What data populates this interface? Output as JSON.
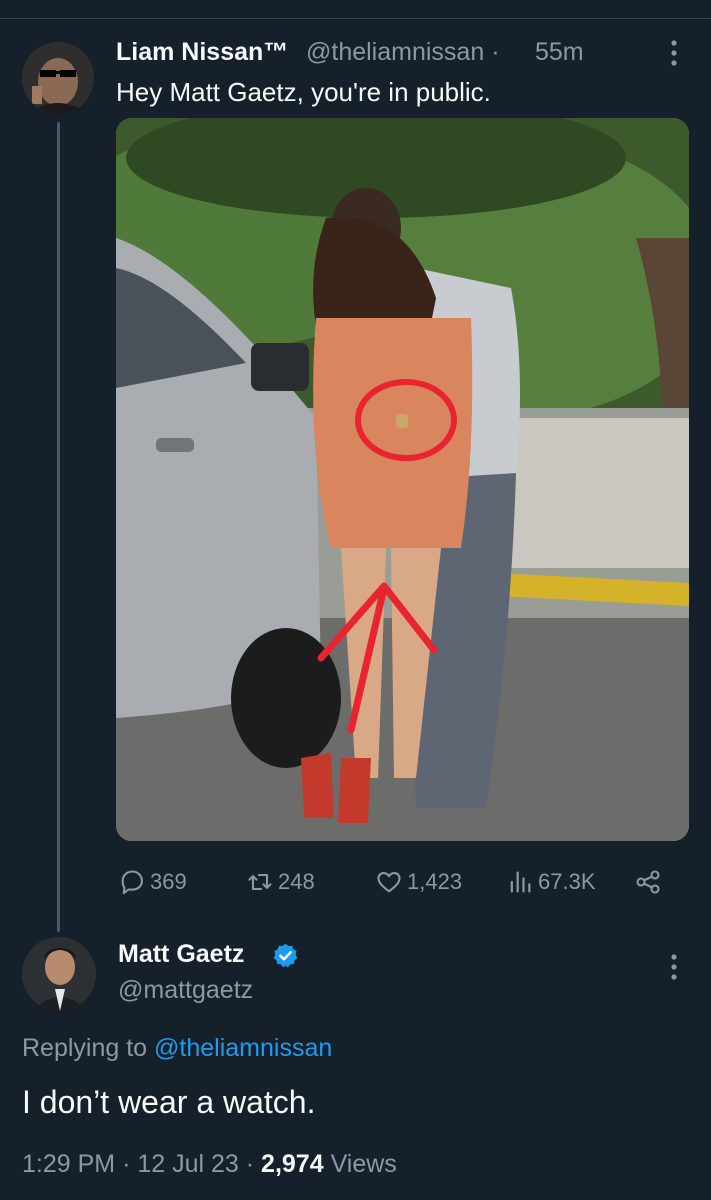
{
  "tweet": {
    "author_name": "Liam Nissan™",
    "author_handle": "@theliamnissan",
    "separator": "·",
    "time": "55m",
    "text": "Hey Matt Gaetz, you're in public.",
    "stats": {
      "replies": "369",
      "retweets": "248",
      "likes": "1,423",
      "views": "67.3K"
    },
    "icons": [
      "more-icon",
      "reply-icon",
      "retweet-icon",
      "like-icon",
      "views-icon",
      "share-icon"
    ]
  },
  "reply": {
    "author_name": "Matt Gaetz",
    "author_handle": "@mattgaetz",
    "verified_color": "#1d9bf0",
    "replying_to_label": "Replying to",
    "replying_to_handle": "@theliamnissan",
    "text": "I don’t wear a watch.",
    "time": "1:29 PM",
    "date": "12 Jul 23",
    "separator": "·",
    "view_count": "2,974",
    "views_label": "Views"
  },
  "colors": {
    "background": "#15202b",
    "text": "#f7f9f9",
    "secondary": "#8b98a5",
    "accent": "#1d9bf0",
    "annotation": "#e8252f"
  }
}
